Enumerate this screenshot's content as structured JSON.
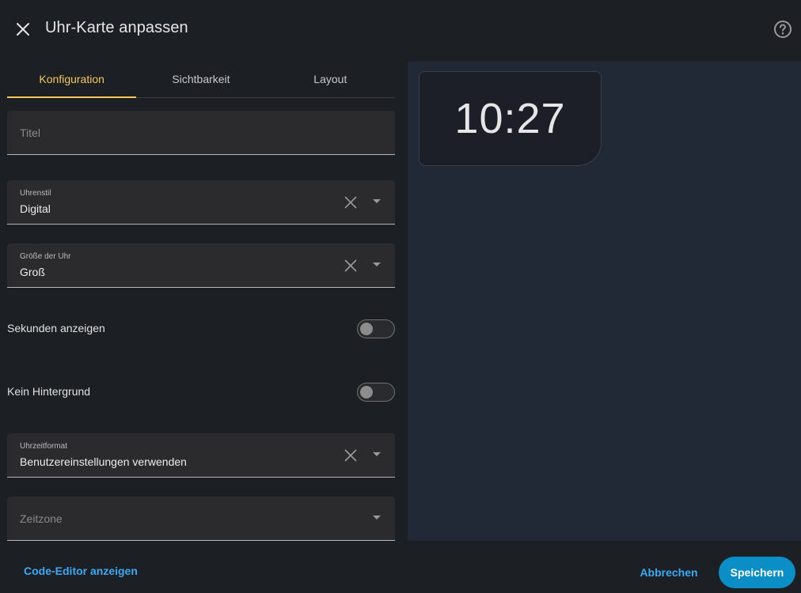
{
  "dialog": {
    "title": "Uhr-Karte anpassen"
  },
  "icons": {
    "close": "close-icon",
    "help": "help-circle-icon",
    "clear": "clear-icon",
    "dropdown": "dropdown-arrow-icon"
  },
  "tabs": [
    {
      "label": "Konfiguration",
      "active": true
    },
    {
      "label": "Sichtbarkeit",
      "active": false
    },
    {
      "label": "Layout",
      "active": false
    }
  ],
  "form": {
    "title_field": {
      "placeholder": "Titel"
    },
    "clock_style": {
      "label": "Uhrenstil",
      "value": "Digital"
    },
    "clock_size": {
      "label": "Größe der Uhr",
      "value": "Groß"
    },
    "show_seconds": {
      "label": "Sekunden anzeigen",
      "checked": false
    },
    "no_background": {
      "label": "Kein Hintergrund",
      "checked": false
    },
    "time_format": {
      "label": "Uhrzeitformat",
      "value": "Benutzereinstellungen verwenden"
    },
    "time_zone": {
      "placeholder": "Zeitzone"
    }
  },
  "preview": {
    "time": "10:27"
  },
  "footer": {
    "code_editor_label": "Code-Editor anzeigen",
    "cancel_label": "Abbrechen",
    "save_label": "Speichern"
  },
  "colors": {
    "accent_tab": "#f5c75f",
    "link": "#3fa9f5",
    "primary_button": "#0b8ec6"
  }
}
